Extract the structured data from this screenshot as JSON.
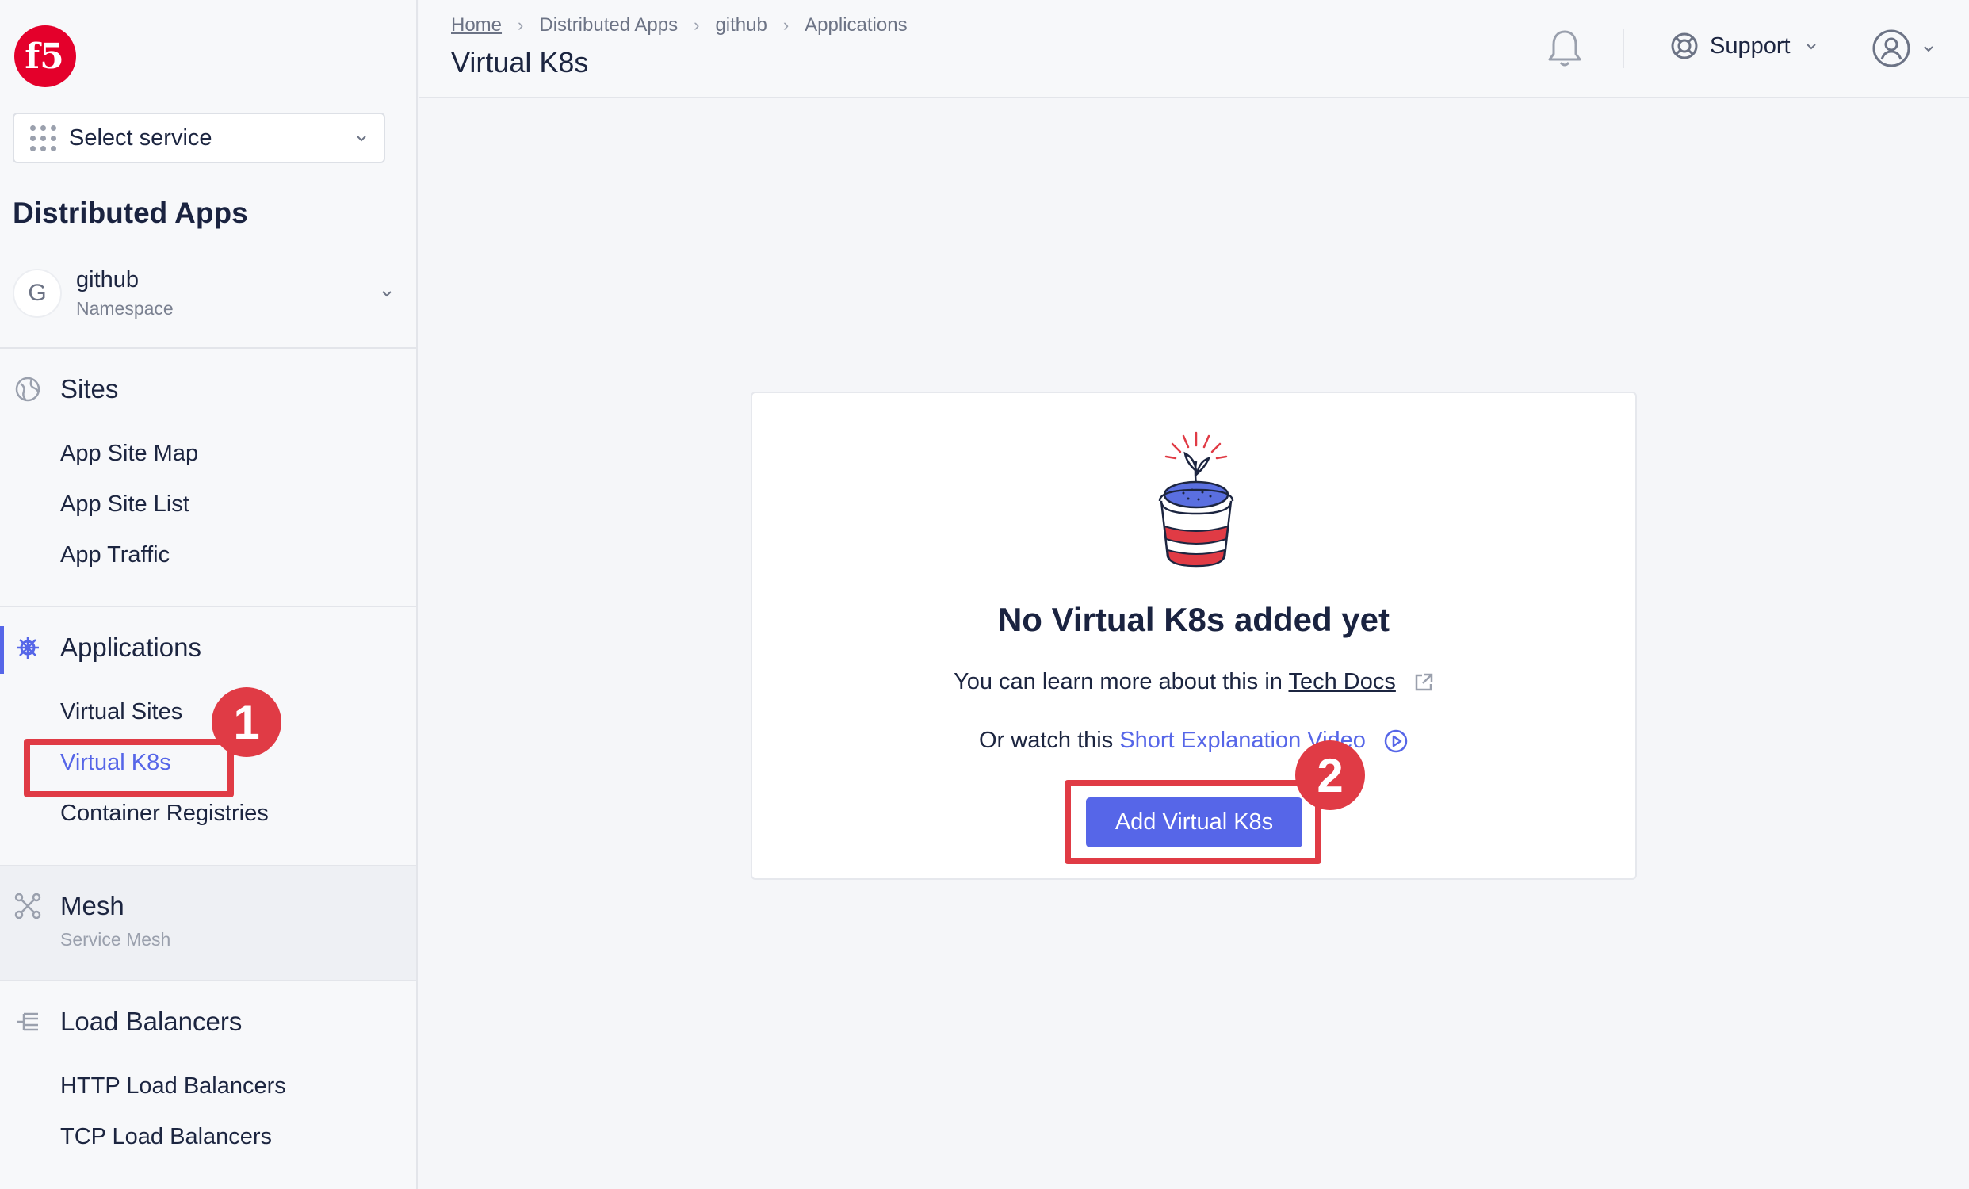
{
  "sidebar": {
    "logo_text": "f5",
    "service_select": {
      "label": "Select service"
    },
    "section_title": "Distributed Apps",
    "namespace": {
      "avatar_letter": "G",
      "name": "github",
      "type": "Namespace"
    },
    "groups": {
      "sites": {
        "label": "Sites",
        "items": [
          "App Site Map",
          "App Site List",
          "App Traffic"
        ]
      },
      "applications": {
        "label": "Applications",
        "items": [
          "Virtual Sites",
          "Virtual K8s",
          "Container Registries"
        ]
      },
      "mesh": {
        "label": "Mesh",
        "sub": "Service Mesh"
      },
      "load_balancers": {
        "label": "Load Balancers",
        "items": [
          "HTTP Load Balancers",
          "TCP Load Balancers"
        ]
      }
    },
    "active_item": "Virtual K8s"
  },
  "header": {
    "breadcrumb": [
      "Home",
      "Distributed Apps",
      "github",
      "Applications"
    ],
    "title": "Virtual K8s",
    "support_label": "Support"
  },
  "empty_state": {
    "title": "No Virtual K8s added yet",
    "learn_prefix": "You can learn more about this in",
    "learn_link": "Tech Docs",
    "watch_prefix": "Or watch this",
    "watch_link": "Short Explanation Video",
    "button_label": "Add Virtual K8s"
  },
  "annotations": {
    "step1": "1",
    "step2": "2"
  },
  "colors": {
    "accent": "#5666e8",
    "highlight": "#e03b45",
    "logo": "#e4002b"
  }
}
